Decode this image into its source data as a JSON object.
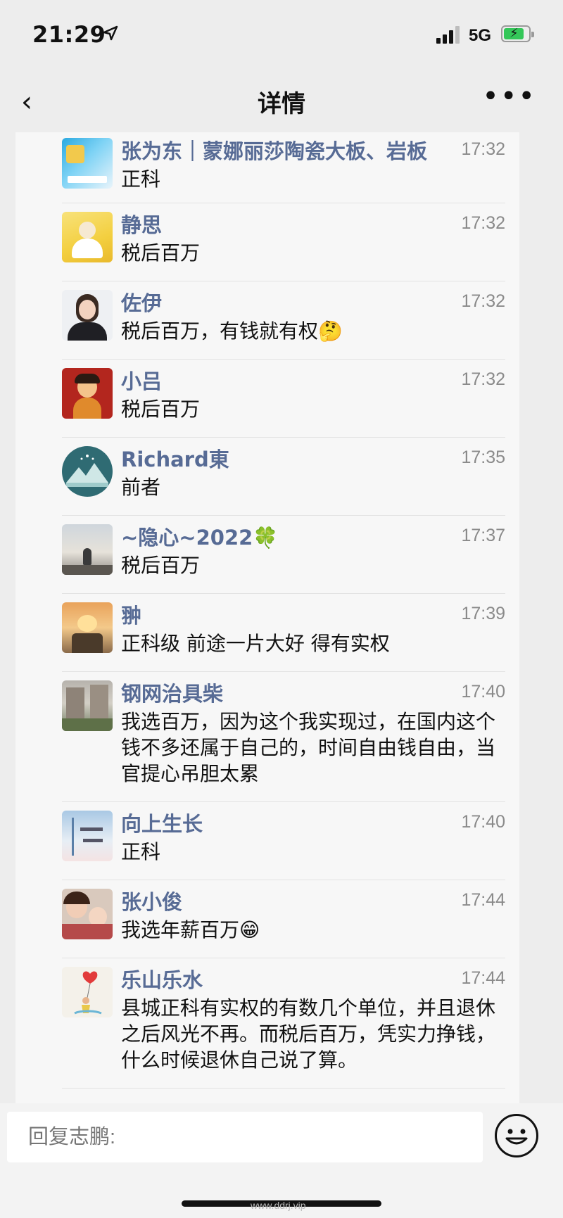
{
  "status_bar": {
    "time": "21:29",
    "network": "5G"
  },
  "nav": {
    "back_icon": "chevron-left-icon",
    "title": "详情",
    "more_icon": "more-dots-icon"
  },
  "comments": [
    {
      "name": "张为东｜蒙娜丽莎陶瓷大板、岩板",
      "time": "17:32",
      "text": "正科"
    },
    {
      "name": "静思",
      "time": "17:32",
      "text": "税后百万"
    },
    {
      "name": "佐伊",
      "time": "17:32",
      "text": "税后百万，有钱就有权🤔"
    },
    {
      "name": "小吕",
      "time": "17:32",
      "text": "税后百万"
    },
    {
      "name": "Richard東",
      "time": "17:35",
      "text": "前者"
    },
    {
      "name": "~隐心~2022🍀",
      "time": "17:37",
      "text": "税后百万"
    },
    {
      "name": "翀",
      "time": "17:39",
      "text": "正科级 前途一片大好 得有实权"
    },
    {
      "name": "钢网治具柴",
      "time": "17:40",
      "text": "我选百万，因为这个我实现过，在国内这个钱不多还属于自己的，时间自由钱自由，当官提心吊胆太累"
    },
    {
      "name": "向上生长",
      "time": "17:40",
      "text": "正科"
    },
    {
      "name": "张小俊",
      "time": "17:44",
      "text": "我选年薪百万😁"
    },
    {
      "name": "乐山乐水",
      "time": "17:44",
      "text": "县城正科有实权的有数几个单位，并且退休之后风光不再。而税后百万，凭实力挣钱，什么时候退休自己说了算。"
    }
  ],
  "reply": {
    "placeholder": "回复志鹏:"
  },
  "watermark": "www.ddrj.vip"
}
